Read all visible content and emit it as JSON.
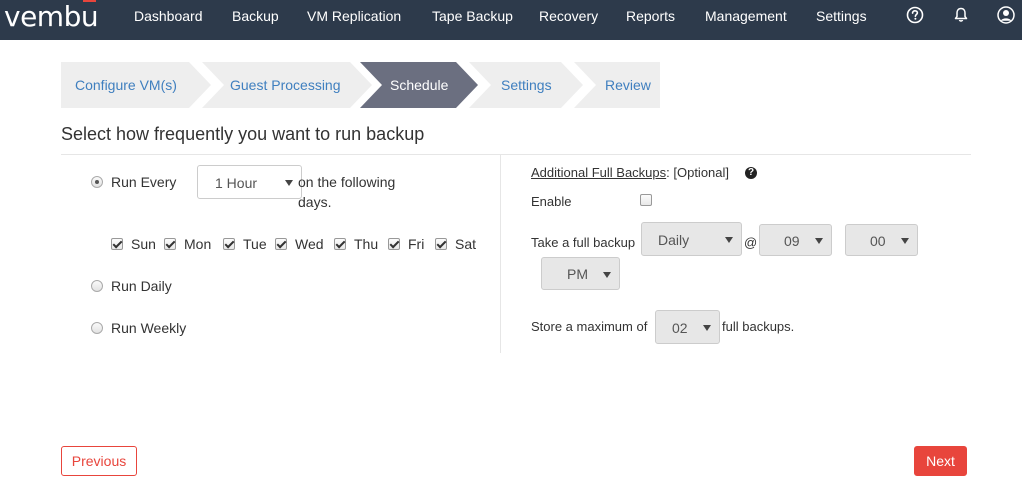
{
  "brand": {
    "logo_prefix": "vemb",
    "logo_u": "u",
    "accent_color": "#e8453c",
    "nav_bg": "#2d3a4b"
  },
  "nav": {
    "items": [
      "Dashboard",
      "Backup",
      "VM Replication",
      "Tape Backup",
      "Recovery",
      "Reports",
      "Management",
      "Settings"
    ],
    "icons": [
      "help-circle-icon",
      "bell-icon",
      "user-avatar-icon"
    ]
  },
  "wizard": {
    "steps": [
      "Configure VM(s)",
      "Guest Processing",
      "Schedule",
      "Settings",
      "Review"
    ],
    "active_step": "Schedule"
  },
  "page": {
    "heading": "Select how frequently you want to run backup"
  },
  "frequency": {
    "run_every_label": "Run Every",
    "interval_value": "1 Hour",
    "following_days_text": "on the following days.",
    "following_days_line1": "on the following",
    "following_days_line2": "days.",
    "days": [
      {
        "label": "Sun",
        "checked": true
      },
      {
        "label": "Mon",
        "checked": true
      },
      {
        "label": "Tue",
        "checked": true
      },
      {
        "label": "Wed",
        "checked": true
      },
      {
        "label": "Thu",
        "checked": true
      },
      {
        "label": "Fri",
        "checked": true
      },
      {
        "label": "Sat",
        "checked": true
      }
    ],
    "run_daily_label": "Run Daily",
    "run_weekly_label": "Run Weekly",
    "selected": "Run Every"
  },
  "full_backups": {
    "title": "Additional Full Backups",
    "optional_text": ": [Optional]",
    "enable_label": "Enable",
    "enable_checked": false,
    "take_label": "Take a full backup",
    "frequency_value": "Daily",
    "at_symbol": "@",
    "hour_value": "09",
    "minute_value": "00",
    "ampm_value": "PM",
    "store_label": "Store a maximum of",
    "max_value": "02",
    "store_suffix": "full backups."
  },
  "buttons": {
    "previous": "Previous",
    "next": "Next"
  }
}
